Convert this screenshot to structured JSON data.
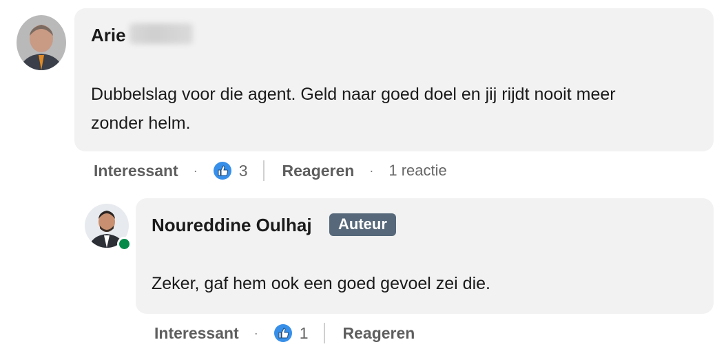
{
  "comment": {
    "author_first_name": "Arie",
    "text": "Dubbelslag voor die agent. Geld naar goed doel en jij rijdt nooit meer zonder helm.",
    "actions": {
      "react_label": "Interessant",
      "reaction_count": "3",
      "reply_label": "Reageren",
      "replies_label": "1 reactie"
    }
  },
  "reply": {
    "author_name": "Noureddine Oulhaj",
    "badge": "Auteur",
    "text": "Zeker, gaf hem ook een goed gevoel zei die.",
    "actions": {
      "react_label": "Interessant",
      "reaction_count": "1",
      "reply_label": "Reageren"
    }
  },
  "colors": {
    "bubble": "#f2f2f2",
    "badge": "#56687a",
    "like_blue": "#378fe9",
    "online": "#058a4a"
  }
}
